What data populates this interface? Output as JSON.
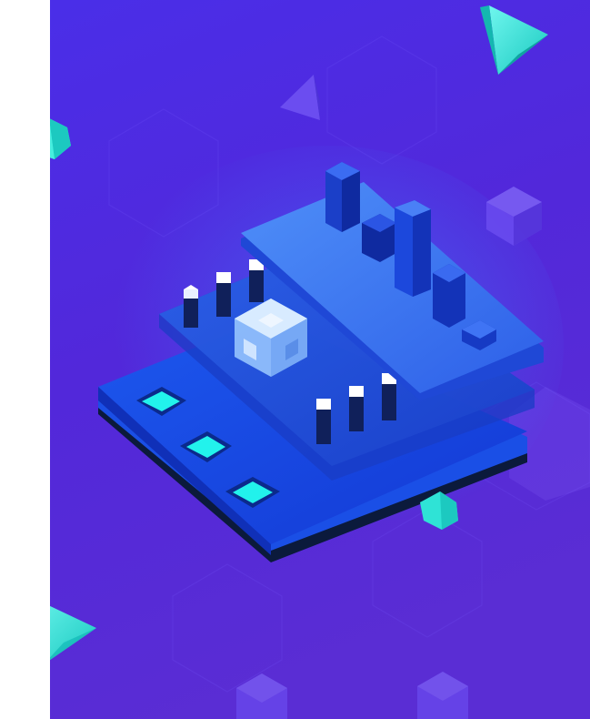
{
  "illustration": {
    "subject": "isometric-circuit-board",
    "colors": {
      "background_top": "#4a2fe0",
      "background_bottom": "#5a2fd6",
      "board_base": "#1646e6",
      "board_dark": "#0d1a3a",
      "plate_mid": "#2f6cf0",
      "plate_top": "#3f7cf4",
      "pad_glow": "#22f2ec",
      "cyan_gem": "#2fe3d6",
      "cube_glow": "#b9dcff",
      "hex_pattern": "#7a5cff"
    },
    "icons": [
      "cyan-gem-icon",
      "pyramid-icon",
      "cube-icon",
      "chip-icon",
      "pillar-icon"
    ]
  }
}
